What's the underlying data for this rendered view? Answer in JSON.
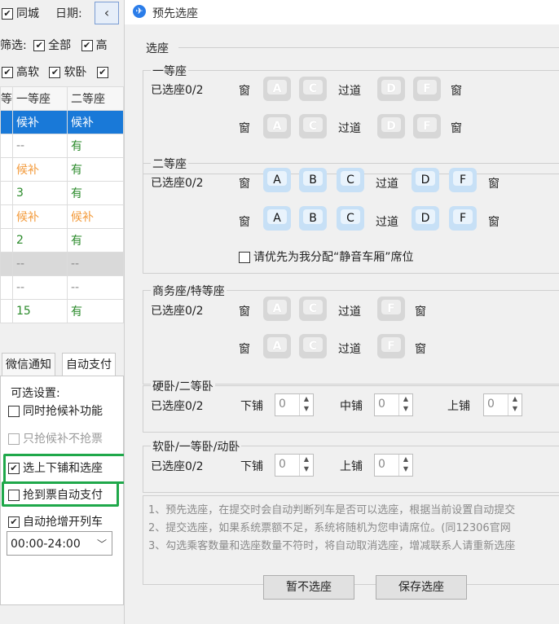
{
  "left_app": {
    "same_city": "同城",
    "date_label": "日期:",
    "date_prev_icon": "‹",
    "filter_label": "筛选:",
    "filter_all": "全部",
    "filter_high": "高",
    "seat_types": [
      "高软",
      "软卧"
    ],
    "table": {
      "headers": [
        "等",
        "一等座",
        "二等座"
      ],
      "rows": [
        {
          "first": "候补",
          "second": "候补",
          "style": "sel"
        },
        {
          "first": "--",
          "second": "有",
          "style": "normal"
        },
        {
          "first": "候补",
          "second": "有",
          "style": "normal"
        },
        {
          "first": "3",
          "second": "有",
          "style": "normal"
        },
        {
          "first": "候补",
          "second": "候补",
          "style": "normal"
        },
        {
          "first": "2",
          "second": "有",
          "style": "normal"
        },
        {
          "first": "--",
          "second": "--",
          "style": "gray"
        },
        {
          "first": "--",
          "second": "--",
          "style": "normal"
        },
        {
          "first": "15",
          "second": "有",
          "style": "normal"
        }
      ]
    },
    "tabs": [
      "微信通知",
      "自动支付"
    ],
    "options_title": "可选设置:",
    "options": [
      {
        "label": "同时抢候补功能",
        "checked": false,
        "disabled": false
      },
      {
        "label": "只抢候补不抢票",
        "checked": false,
        "disabled": true
      },
      {
        "label": "选上下铺和选座",
        "checked": true,
        "disabled": false
      },
      {
        "label": "抢到票自动支付",
        "checked": false,
        "disabled": false
      },
      {
        "label": "自动抢增开列车",
        "checked": true,
        "disabled": false
      }
    ],
    "time_range": "00:00-24:00",
    "highlight_color": "#1fa84a"
  },
  "dialog": {
    "title": "预先选座",
    "section_title": "选座",
    "window_label": "窗",
    "aisle_label": "过道",
    "first_class": {
      "title": "一等座",
      "selected": "已选座0/2",
      "left_seats": [
        "A",
        "C"
      ],
      "right_seats": [
        "D",
        "F"
      ],
      "enabled": false
    },
    "second_class": {
      "title": "二等座",
      "selected": "已选座0/2",
      "left_seats": [
        "A",
        "B",
        "C"
      ],
      "right_seats": [
        "D",
        "F"
      ],
      "enabled": true,
      "quiet_car_option": "请优先为我分配“静音车厢”席位",
      "quiet_car_checked": false
    },
    "business_class": {
      "title": "商务座/特等座",
      "selected": "已选座0/2",
      "left_seats": [
        "A",
        "C"
      ],
      "right_seats": [
        "F"
      ],
      "enabled": false
    },
    "hard_sleeper": {
      "title": "硬卧/二等卧",
      "selected": "已选座0/2",
      "lower_label": "下铺",
      "middle_label": "中铺",
      "upper_label": "上铺",
      "lower": "0",
      "middle": "0",
      "upper": "0"
    },
    "soft_sleeper": {
      "title": "软卧/一等卧/动卧",
      "selected": "已选座0/2",
      "lower_label": "下铺",
      "upper_label": "上铺",
      "lower": "0",
      "upper": "0"
    },
    "notes": [
      "1、预先选座，在提交时会自动判断列车是否可以选座，根据当前设置自动提交",
      "2、提交选座，如果系统票额不足，系统将随机为您申请席位。(同12306官网",
      "3、勾选乘客数量和选座数量不符时，将自动取消选座，增减联系人请重新选座"
    ],
    "buttons": {
      "skip": "暂不选座",
      "save": "保存选座"
    },
    "colors": {
      "seat_active": "#c7e0f6",
      "seat_disabled": "#d7d7d7",
      "selected_row": "#1979d8"
    }
  }
}
